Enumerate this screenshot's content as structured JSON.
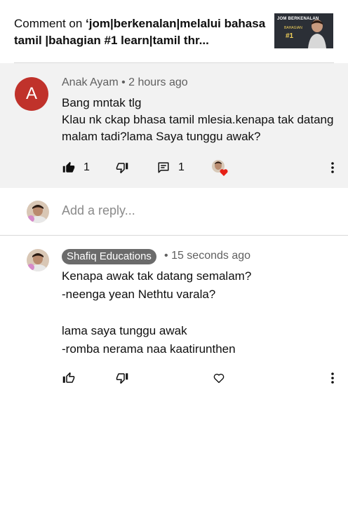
{
  "header": {
    "prefix": "Comment on ",
    "video_title": "‘jom|berkenalan|melalui bahasa tamil |bahagian #1 learn|tamil thr...",
    "thumbnail": {
      "line1": "JOM BERKENALAN",
      "line2": "BAHAGIAN",
      "line3": "#1"
    }
  },
  "parent_comment": {
    "avatar_letter": "A",
    "author": "Anak Ayam",
    "separator": "•",
    "time": "2 hours ago",
    "text_line1": "Bang mntak tlg",
    "text_line2": "Klau nk ckap bhasa tamil mlesia.kenapa tak datang malam tadi?lama Saya tunggu awak?",
    "like_count": "1",
    "reply_count": "1",
    "icons": {
      "like": "thumbs-up-filled-icon",
      "dislike": "thumbs-down-icon",
      "reply": "comment-icon",
      "creator_heart": "creator-heart-icon",
      "more": "more-vert-icon"
    }
  },
  "reply_bar": {
    "placeholder": "Add a reply..."
  },
  "reply_comment": {
    "author": "Shafiq Educations",
    "separator": "•",
    "time": "15 seconds ago",
    "text": "Kenapa awak  tak datang semalam?\n-neenga yean Nethtu  varala?\n\nlama saya tunggu awak\n-romba nerama naa  kaatirunthen",
    "icons": {
      "like": "thumbs-up-icon",
      "dislike": "thumbs-down-icon",
      "heart": "heart-icon",
      "more": "more-vert-icon"
    }
  },
  "colors": {
    "avatar_a": "#c0322b",
    "badge_bg": "#6b6b6b",
    "parent_bg": "#f2f2f2",
    "heart_red": "#e62117"
  }
}
